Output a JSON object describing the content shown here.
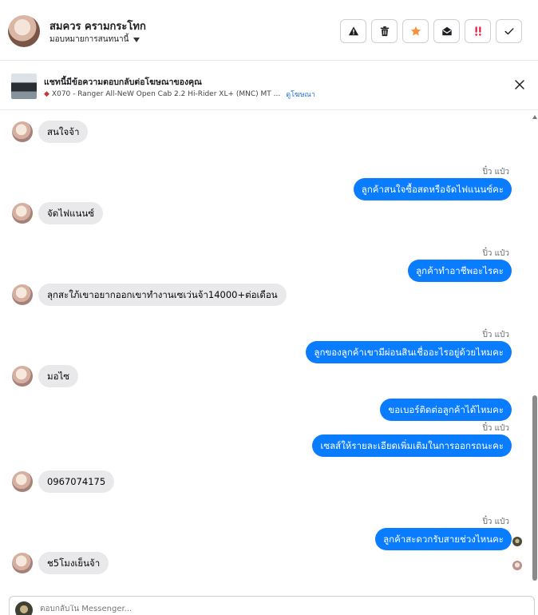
{
  "header": {
    "name": "สมควร ครามกระโทก",
    "assign_label": "มอบหมายการสนทนานี้",
    "toolbar": [
      {
        "name": "mark-spam-button",
        "icon": "warning-icon",
        "color": "#1c1e21"
      },
      {
        "name": "delete-button",
        "icon": "trash-icon",
        "color": "#1c1e21"
      },
      {
        "name": "star-button",
        "icon": "star-icon",
        "color": "#f7923b"
      },
      {
        "name": "mark-unread-button",
        "icon": "envelope-open-icon",
        "color": "#1c1e21"
      },
      {
        "name": "follow-up-button",
        "icon": "double-exclamation-icon",
        "color": "#e41e3f"
      },
      {
        "name": "mark-done-button",
        "icon": "check-icon",
        "color": "#1c1e21"
      }
    ]
  },
  "ad": {
    "title": "แชทนี้มีข้อความตอบกลับต่อโฆษณาของคุณ",
    "product": "X070 - Ranger All-NeW Open Cab 2.2 Hi-Rider XL+ (MNC) MT ...",
    "link": "ดูโฆษณา",
    "car_icon": "car-icon"
  },
  "sender_name": "ปิ๋ว แป๋ว",
  "messages": [
    {
      "dir": "in",
      "text": "สนใจจ้า"
    },
    {
      "dir": "out",
      "text": "ลูกค้าสนใจซื้อสดหรือจัดไฟแนนซ์คะ",
      "sender": true
    },
    {
      "dir": "in",
      "text": "จัดไฟแนนซ์"
    },
    {
      "dir": "out",
      "text": "ลูกค้าทำอาชีพอะไรคะ",
      "sender": true
    },
    {
      "dir": "in",
      "text": "ลุกสะใภ้เขาอยากออกเขาทำงานเซเว่นจ้า14000+ต่อเดือน"
    },
    {
      "dir": "out",
      "text": "ลูกของลูกค้าเขามีผ่อนสินเชื่ออะไรอยู่ด้วยไหมคะ",
      "sender": true
    },
    {
      "dir": "in",
      "text": "มอไซ"
    },
    {
      "dir": "out",
      "text": "ขอเบอร์ติดต่อลูกค้าได้ไหมคะ"
    },
    {
      "dir": "out",
      "text": "เซลส์ให้รายละเอียดเพิ่มเติมในการออกรถนะคะ",
      "sender": true
    },
    {
      "dir": "in",
      "text": "0967074175"
    },
    {
      "dir": "out",
      "text": "ลูกค้าสะดวกรับสายช่วงไหนคะ",
      "sender": true,
      "seen": "dark"
    },
    {
      "dir": "in",
      "text": "ช5โมงเย็นจ้า",
      "seen": "light"
    }
  ],
  "composer": {
    "placeholder": "ตอบกลับใน Messenger..."
  }
}
